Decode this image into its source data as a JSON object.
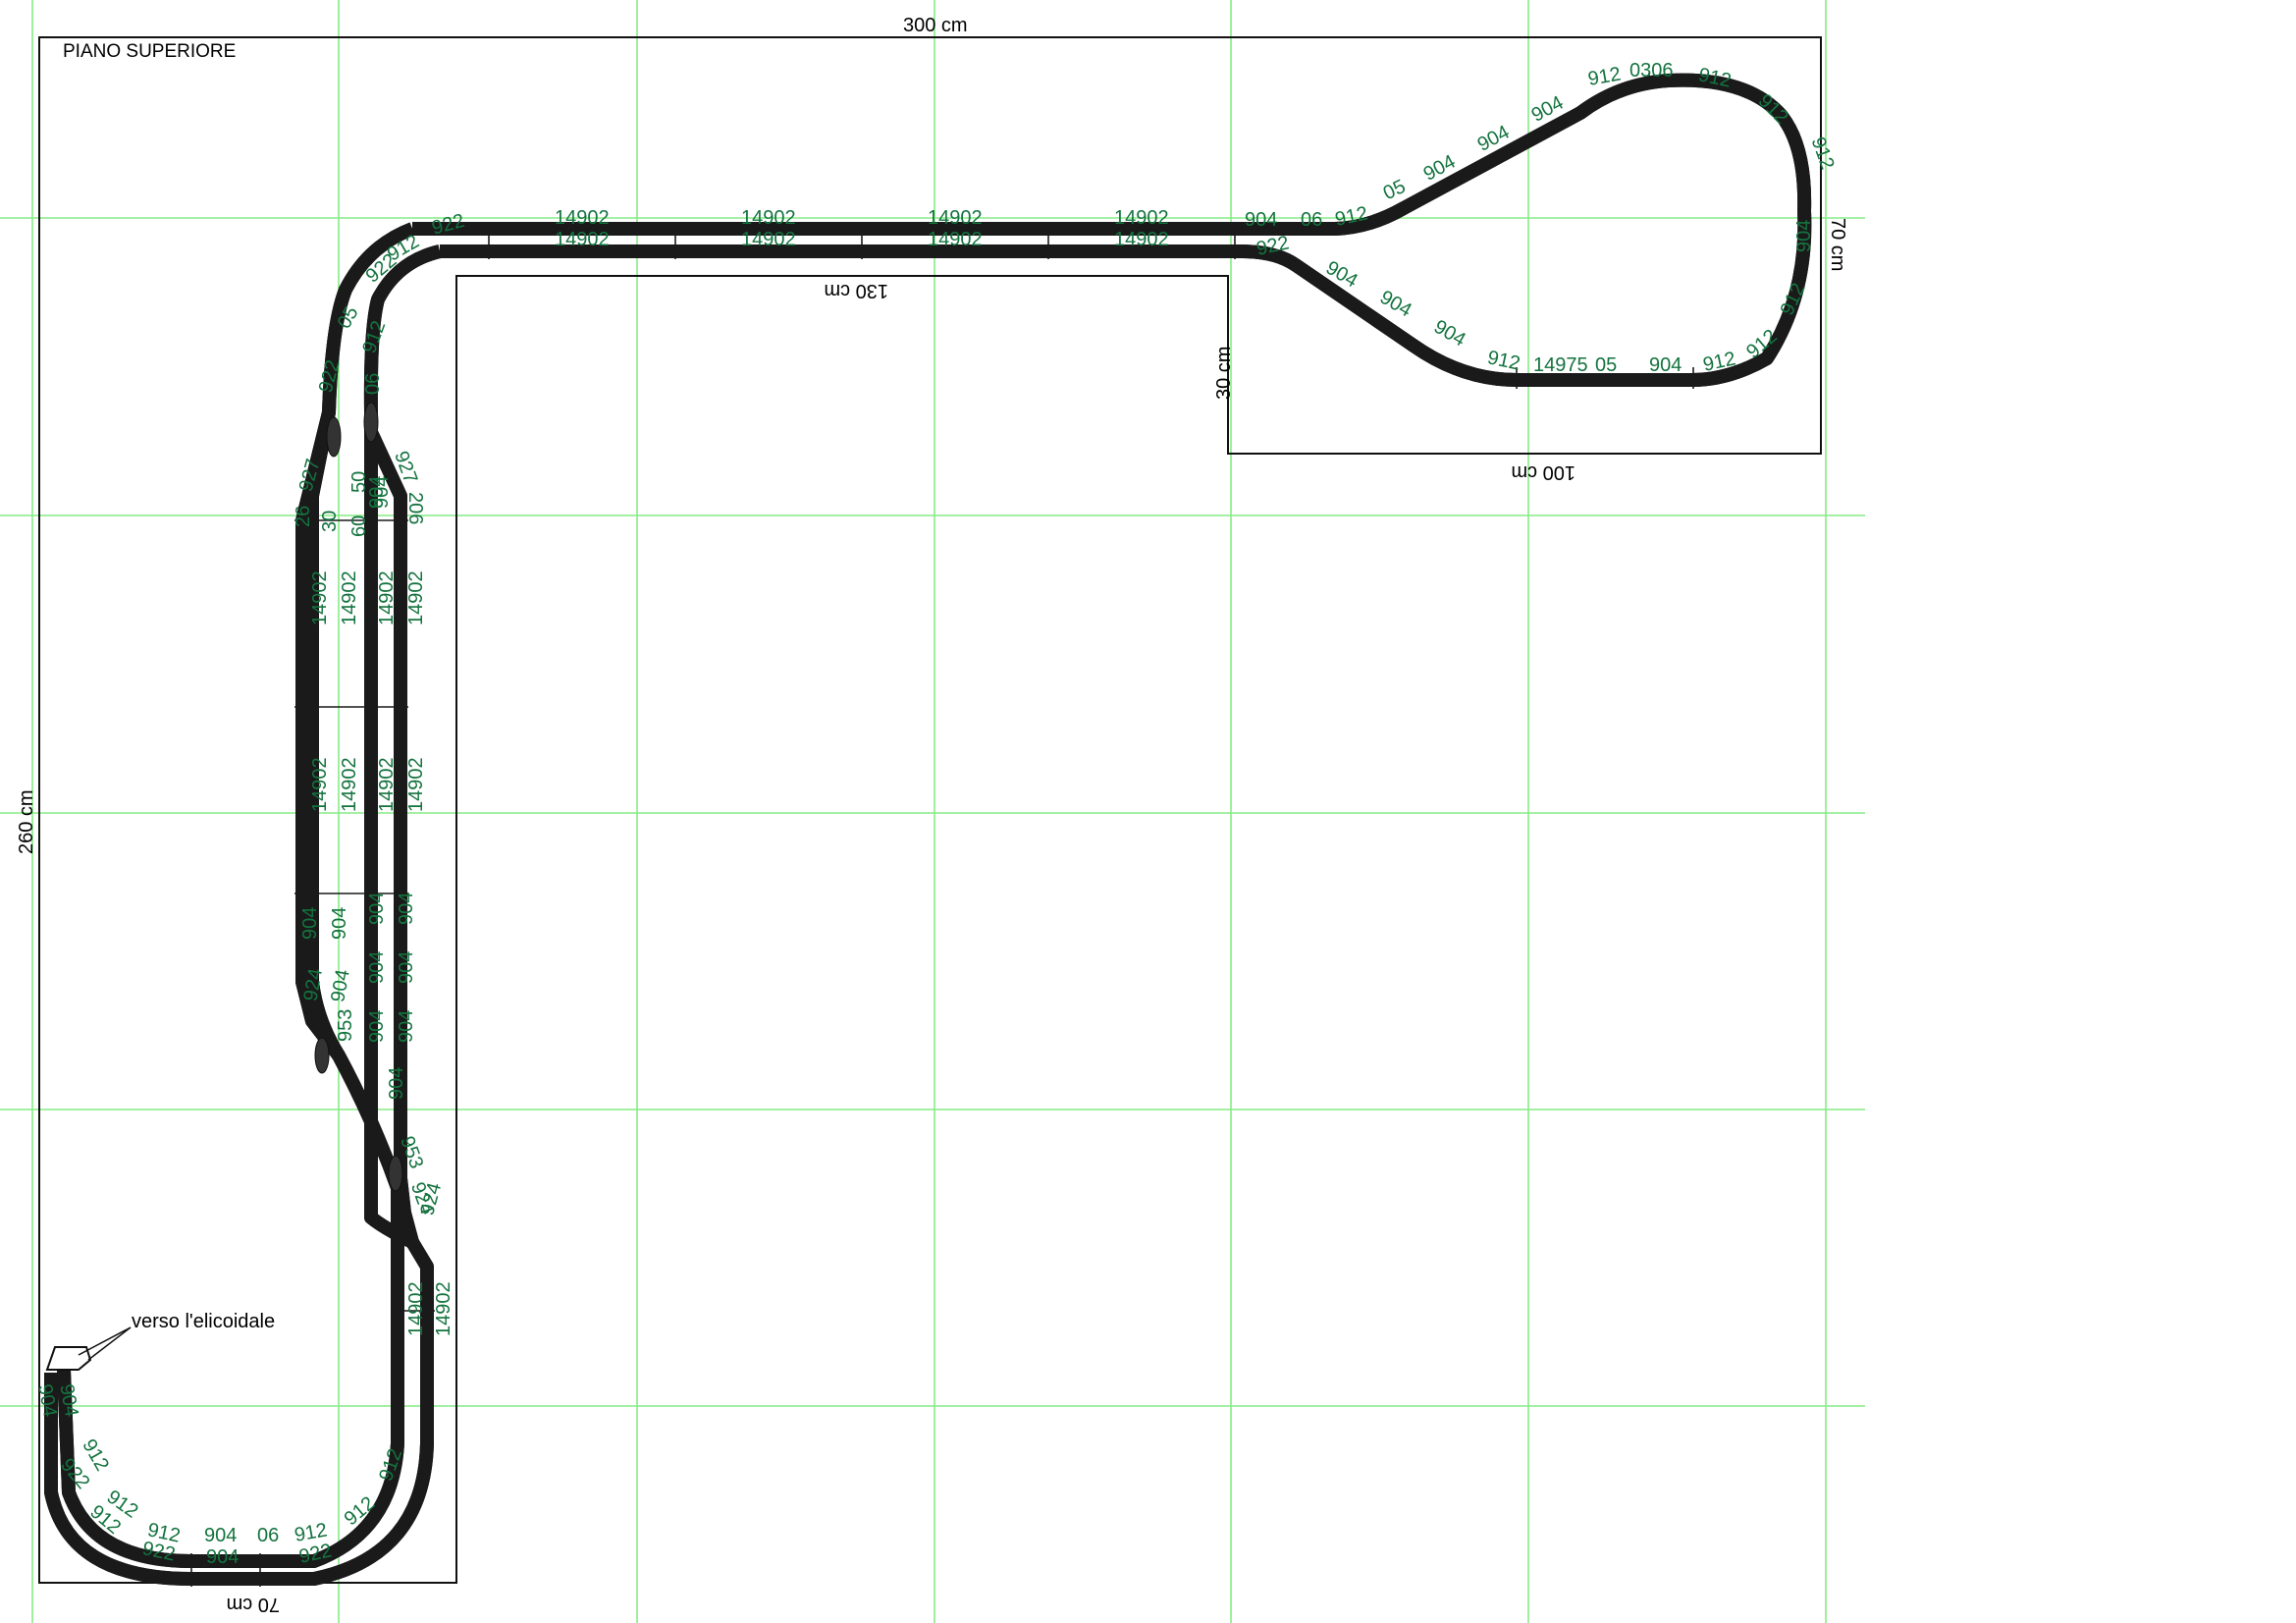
{
  "title": "PIANO SUPERIORE",
  "dimensions": {
    "top": "300 cm",
    "left": "260 cm",
    "right": "70 cm",
    "bottom": "70 cm",
    "inner_top": "130 cm",
    "step_left": "30 cm",
    "step_bottom": "100 cm"
  },
  "annotation": "verso l'elicoidale",
  "colors": {
    "grid": "#86ec86",
    "track": "#8ee27a",
    "piece_label": "#14733f"
  },
  "piece_labels": {
    "top_straights": [
      "14902",
      "14902",
      "14902",
      "14902"
    ],
    "top_straights_inner": [
      "14902",
      "14902",
      "14902",
      "14902"
    ],
    "loop_upper": [
      "904",
      "06",
      "912",
      "05",
      "904",
      "904",
      "904",
      "912",
      "0306",
      "912",
      "912",
      "912"
    ],
    "loop_lower": [
      "922",
      "904",
      "904",
      "904",
      "912",
      "14975",
      "05",
      "904",
      "912",
      "912",
      "912",
      "904"
    ],
    "upper_left_curve": [
      "922",
      "922",
      "05",
      "922",
      "912",
      "912",
      "06"
    ],
    "station_left": [
      "927",
      "26",
      "30",
      "60",
      "50",
      "904",
      "14902",
      "14902",
      "14902",
      "14902",
      "904",
      "904",
      "924",
      "904"
    ],
    "station_right": [
      "927",
      "206",
      "904",
      "14902",
      "14902",
      "14902",
      "14902",
      "904",
      "904",
      "904",
      "904",
      "904",
      "904",
      "904"
    ],
    "station_crossings": [
      "953",
      "953",
      "924",
      "924"
    ],
    "lower_straight": [
      "14902",
      "14902"
    ],
    "bottom_loop": [
      "904",
      "904",
      "912",
      "922",
      "912",
      "912",
      "904",
      "06",
      "912",
      "912",
      "912",
      "922",
      "904",
      "922",
      "912"
    ]
  }
}
